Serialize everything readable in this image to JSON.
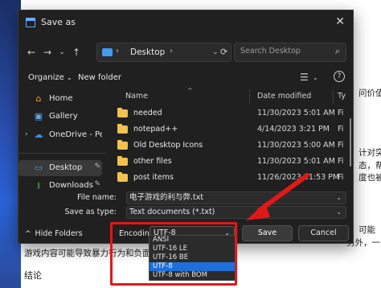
{
  "background": {
    "right_text_lines": [
      "问价值，",
      "计对突发",
      "态，帮助",
      "度也被用",
      "可能",
      "另外，一"
    ],
    "bottom_line": "游戏内容可能导致暴力行为和负面",
    "conclusion_heading": "结论"
  },
  "dialog": {
    "title": "Save as",
    "close_label": "✕",
    "nav": {
      "back": "←",
      "forward": "→",
      "up_dropdown": "⌄",
      "up": "↑",
      "breadcrumb": [
        "Desktop"
      ],
      "address_dropdown": "⌄",
      "refresh": "⟳",
      "search_placeholder": "Search Desktop"
    },
    "toolbar": {
      "organize": "Organize",
      "new_folder": "New folder",
      "view_icon": "view-list-icon",
      "help": "?"
    },
    "sidebar": {
      "items": [
        {
          "label": "Home",
          "icon": "home-icon",
          "glyph": "⌂"
        },
        {
          "label": "Gallery",
          "icon": "gallery-icon",
          "glyph": "▣"
        },
        {
          "label": "OneDrive - Perso",
          "icon": "cloud-icon",
          "glyph": "☁"
        },
        {
          "label": "Desktop",
          "icon": "desktop-icon",
          "glyph": "▭",
          "selected": true
        },
        {
          "label": "Downloads",
          "icon": "download-icon",
          "glyph": "⭳"
        }
      ]
    },
    "columns": {
      "name": "Name",
      "date": "Date modified",
      "type": "Ty"
    },
    "files": [
      {
        "name": "needed",
        "date": "11/30/2023 5:01 AM",
        "type": "Fi"
      },
      {
        "name": "notepad++",
        "date": "4/14/2023 3:21 PM",
        "type": "Fi"
      },
      {
        "name": "Old Desktop Icons",
        "date": "11/30/2023 5:00 AM",
        "type": "Fi"
      },
      {
        "name": "other files",
        "date": "11/30/2023 5:01 AM",
        "type": "Fi"
      },
      {
        "name": "post items",
        "date": "11/26/2023 11:53 PM",
        "type": "Fi"
      }
    ],
    "form": {
      "file_name_label": "File name:",
      "file_name_value": "电子游戏的利与弊.txt",
      "save_as_type_label": "Save as type:",
      "save_as_type_value": "Text documents (*.txt)"
    },
    "footer": {
      "hide_folders": "Hide Folders",
      "encoding_label": "Encoding:",
      "encoding_value": "UTF-8",
      "save": "Save",
      "cancel": "Cancel"
    },
    "encoding_options": [
      "ANSI",
      "UTF-16 LE",
      "UTF-16 BE",
      "UTF-8",
      "UTF-8 with BOM"
    ],
    "encoding_selected": "UTF-8"
  },
  "annotation": {
    "highlight_color": "#e01818",
    "arrow_color": "#e01818"
  }
}
